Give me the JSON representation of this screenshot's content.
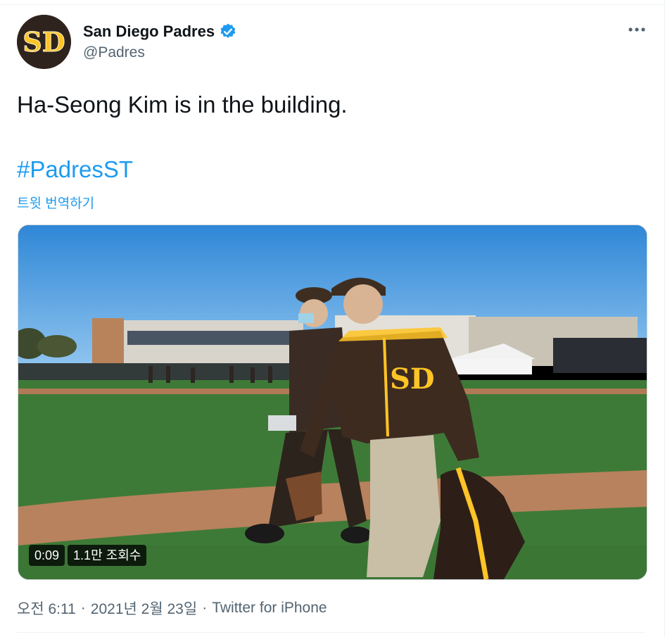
{
  "account": {
    "display_name": "San Diego Padres",
    "handle": "@Padres",
    "avatar_logo_text": "SD",
    "verified": true
  },
  "tweet": {
    "text": "Ha-Seong Kim is in the building.",
    "hashtag": "#PadresST",
    "translate_label": "트윗 번역하기"
  },
  "video": {
    "duration": "0:09",
    "views": "1.1만 조회수"
  },
  "meta": {
    "time": "오전 6:11",
    "date": "2021년 2월 23일",
    "separator": "·",
    "source": "Twitter for iPhone"
  },
  "colors": {
    "link": "#1d9bf0",
    "secondary_text": "#536471",
    "padres_brown": "#2f241d",
    "padres_gold": "#ffc425"
  },
  "icons": {
    "verified": "verified-badge-icon",
    "more": "more-horizontal-icon"
  }
}
